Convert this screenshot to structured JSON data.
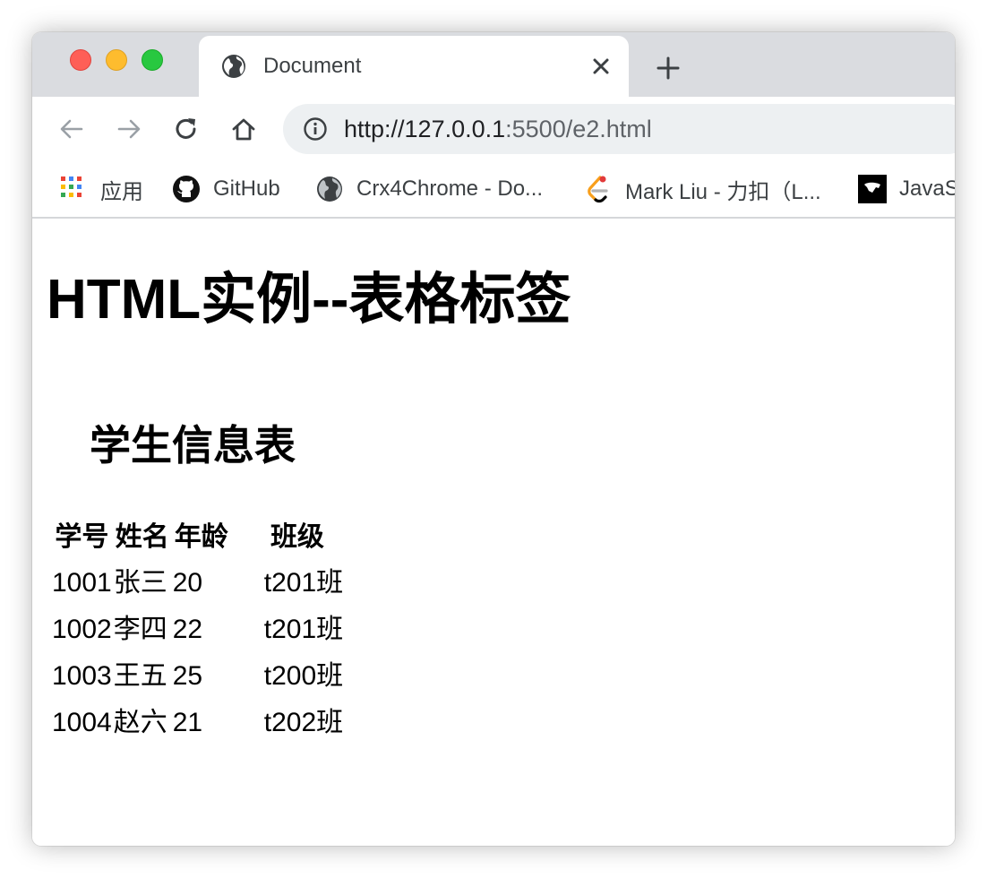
{
  "browser": {
    "tab": {
      "title": "Document",
      "icon": "globe-icon"
    },
    "toolbar": {
      "url_main": "http://127.0.0.1",
      "url_rest": ":5500/e2.html"
    },
    "bookmarks": [
      {
        "label": "应用",
        "icon": "apps-grid-icon"
      },
      {
        "label": "GitHub",
        "icon": "github-icon"
      },
      {
        "label": "Crx4Chrome - Do...",
        "icon": "globe-icon"
      },
      {
        "label": "Mark Liu - 力扣（L...",
        "icon": "leetcode-icon"
      },
      {
        "label": "JavaS",
        "icon": "js-site-icon"
      }
    ]
  },
  "page": {
    "heading": "HTML实例--表格标签",
    "table": {
      "caption": "学生信息表",
      "headers": [
        "学号",
        "姓名",
        "年龄",
        "班级"
      ],
      "rows": [
        [
          "1001",
          "张三",
          "20",
          "t201班"
        ],
        [
          "1002",
          "李四",
          "22",
          "t201班"
        ],
        [
          "1003",
          "王五",
          "25",
          "t200班"
        ],
        [
          "1004",
          "赵六",
          "21",
          "t202班"
        ]
      ]
    }
  }
}
